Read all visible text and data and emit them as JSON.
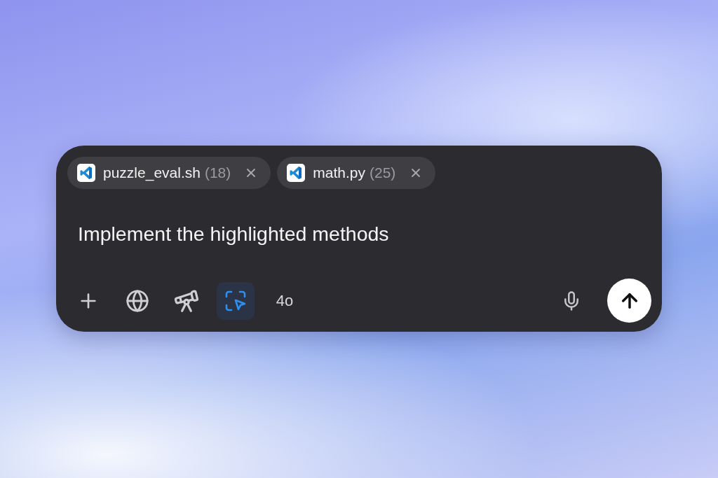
{
  "attachments": [
    {
      "filename": "puzzle_eval.sh",
      "count": "(18)"
    },
    {
      "filename": "math.py",
      "count": "(25)"
    }
  ],
  "prompt": {
    "value": "Implement the highlighted methods"
  },
  "toolbar": {
    "tools": [
      {
        "kind": "add",
        "selected": false
      },
      {
        "kind": "web",
        "selected": false
      },
      {
        "kind": "research",
        "selected": false
      },
      {
        "kind": "screen",
        "selected": true
      }
    ],
    "model": "4o"
  }
}
